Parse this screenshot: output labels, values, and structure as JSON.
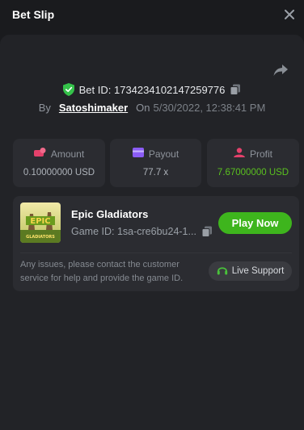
{
  "header": {
    "title": "Bet Slip"
  },
  "bet": {
    "id_label": "Bet ID: 1734234102147259776",
    "by_label": "By",
    "user": "Satoshimaker",
    "on_label": "On",
    "date": "5/30/2022, 12:38:41 PM"
  },
  "stats": [
    {
      "label": "Amount",
      "value": "0.10000000 USD",
      "icon": "amount-icon",
      "color": "#e4416b"
    },
    {
      "label": "Payout",
      "value": "77.7 x",
      "icon": "payout-icon",
      "color": "#8b5cf6"
    },
    {
      "label": "Profit",
      "value": "7.67000000 USD",
      "icon": "profit-icon",
      "color": "#e4416b"
    }
  ],
  "game": {
    "name": "Epic Gladiators",
    "id": "Game ID: 1sa-cre6bu24-1...",
    "play_label": "Play Now",
    "thumb_title": "EPIC",
    "thumb_sub": "GLADIATORS"
  },
  "support": {
    "notice": "Any issues, please contact the customer service for help and provide the game ID.",
    "live_label": "Live Support"
  },
  "colors": {
    "accent_green": "#3eb51d",
    "profit_green": "#5ac01f",
    "shield_green": "#35c24a"
  }
}
